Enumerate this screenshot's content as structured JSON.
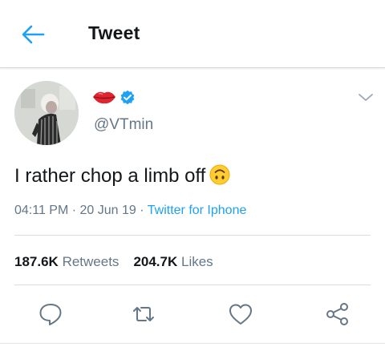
{
  "header": {
    "title": "Tweet",
    "back_icon": "arrow-left-icon"
  },
  "tweet": {
    "display_name_icons": [
      "lips-emoji-icon",
      "verified-badge-icon"
    ],
    "handle": "@VTmin",
    "text": "I rather chop a limb off",
    "text_emoji": "upside-down-face-emoji-icon",
    "time": "04:11 PM",
    "date": "20 Jun 19",
    "separator": "·",
    "source": "Twitter for Iphone"
  },
  "stats": {
    "retweets_count": "187.6K",
    "retweets_label": "Retweets",
    "likes_count": "204.7K",
    "likes_label": "Likes"
  },
  "actions": [
    "reply-icon",
    "retweet-icon",
    "like-icon",
    "share-icon"
  ],
  "colors": {
    "accent": "#1da1f2",
    "secondary_text": "#657786",
    "primary_text": "#14171a",
    "lips": "#e0242f"
  }
}
